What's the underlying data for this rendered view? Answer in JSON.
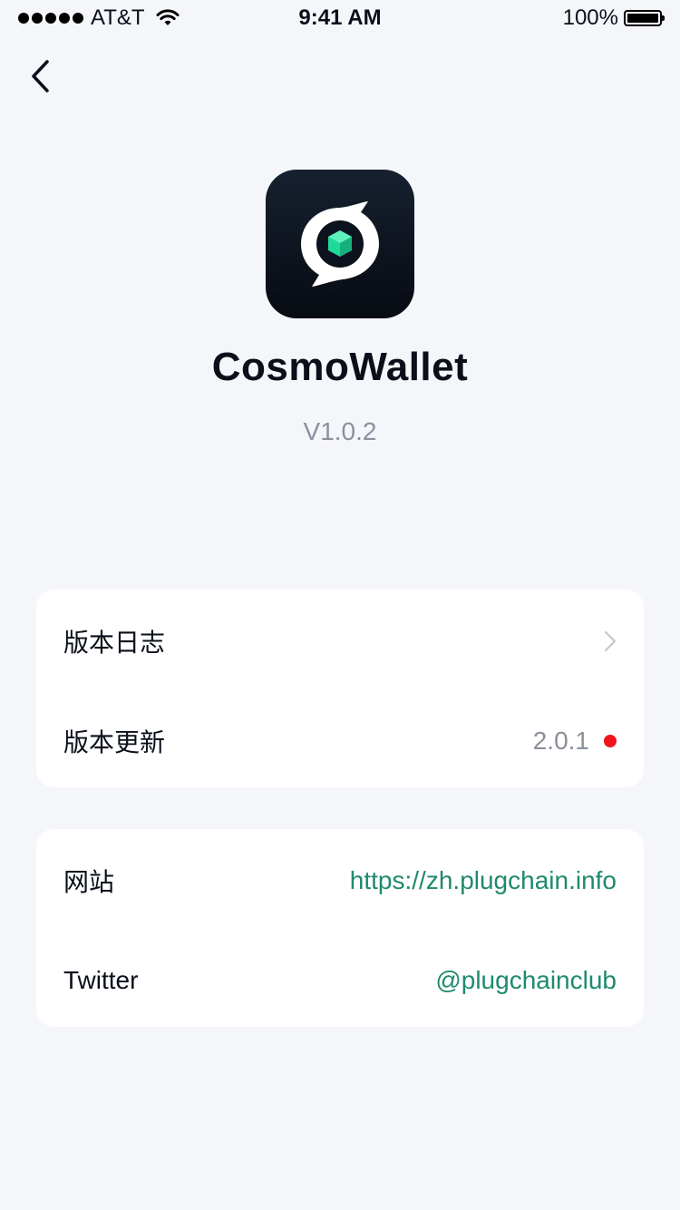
{
  "status_bar": {
    "carrier": "AT&T",
    "time": "9:41 AM",
    "battery": "100%",
    "battery_level": 1.0
  },
  "header": {
    "back_icon": "chevron-left-icon"
  },
  "app": {
    "name": "CosmoWallet",
    "version": "V1.0.2",
    "logo_icon": "cosmowallet-logo",
    "accent_color": "#1fd99a"
  },
  "card_version": {
    "rows": [
      {
        "label": "版本日志",
        "trailing_icon": "chevron-right-icon"
      },
      {
        "label": "版本更新",
        "value": "2.0.1",
        "badge_color": "#f0141e"
      }
    ]
  },
  "card_links": {
    "rows": [
      {
        "label": "网站",
        "value": "https://zh.plugchain.info"
      },
      {
        "label": "Twitter",
        "value": "@plugchainclub"
      }
    ],
    "link_color": "#1f8a6c"
  }
}
